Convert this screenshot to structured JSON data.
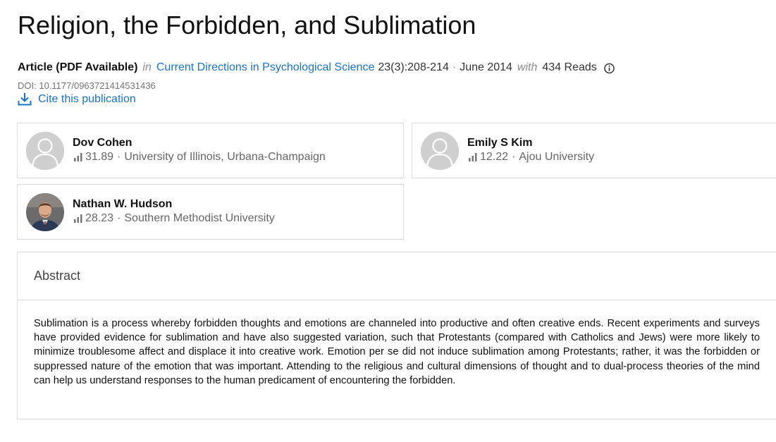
{
  "publication": {
    "title": "Religion, the Forbidden, and Sublimation",
    "type": "Article (PDF Available)",
    "in_label": "in",
    "journal": "Current Directions in Psychological Science",
    "volume_pages": "23(3):208-214",
    "separator": "·",
    "date": "June 2014",
    "with_label": "with",
    "reads": "434 Reads",
    "doi": "DOI: 10.1177/0963721414531436",
    "cite_label": "Cite this publication"
  },
  "authors": [
    {
      "name": "Dov Cohen",
      "score": "31.89",
      "affiliation": "University of Illinois, Urbana-Champaign",
      "avatar": "placeholder"
    },
    {
      "name": "Emily S Kim",
      "score": "12.22",
      "affiliation": "Ajou University",
      "avatar": "placeholder"
    },
    {
      "name": "Nathan W. Hudson",
      "score": "28.23",
      "affiliation": "Southern Methodist University",
      "avatar": "photo"
    }
  ],
  "abstract": {
    "heading": "Abstract",
    "text": "Sublimation is a process whereby forbidden thoughts and emotions are channeled into productive and often creative ends. Recent experiments and surveys have provided evidence for sublimation and have also suggested variation, such that Protestants (compared with Catholics and Jews) were more likely to minimize troublesome affect and displace it into creative work. Emotion per se did not induce sublimation among Protestants; rather, it was the forbidden or suppressed nature of the emotion that was important. Attending to the religious and cultural dimensions of thought and to dual-process theories of the mind can help us understand responses to the human predicament of encountering the forbidden."
  },
  "colors": {
    "link": "#1a73c8",
    "muted": "#8a8a8a",
    "border": "#dcdcdc"
  },
  "icons": {
    "info": "info-circle-icon",
    "cite": "download-icon",
    "score": "bar-chart-icon",
    "avatar_placeholder": "user-silhouette-icon"
  }
}
